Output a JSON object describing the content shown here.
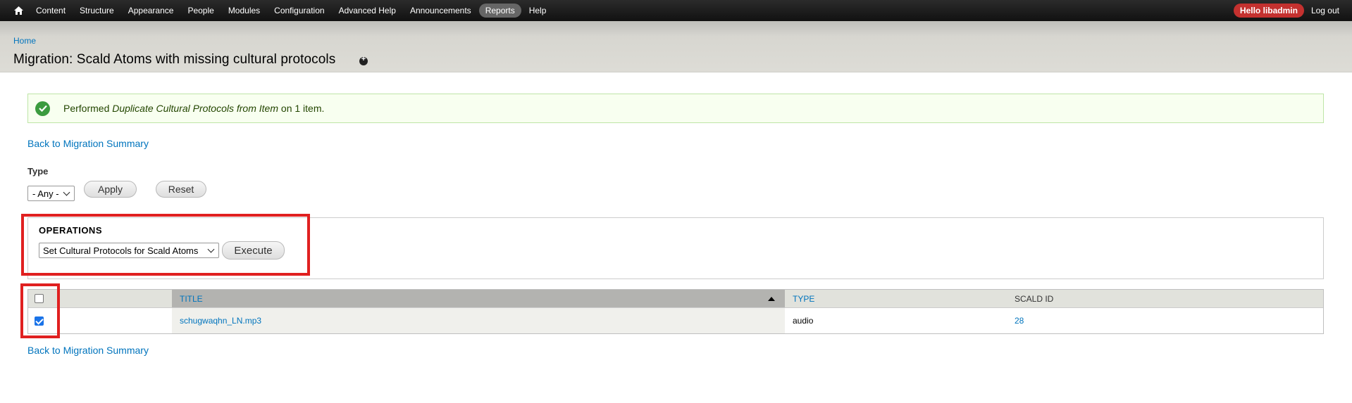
{
  "toolbar": {
    "home_icon": "home-icon",
    "items": [
      {
        "label": "Content"
      },
      {
        "label": "Structure"
      },
      {
        "label": "Appearance"
      },
      {
        "label": "People"
      },
      {
        "label": "Modules"
      },
      {
        "label": "Configuration"
      },
      {
        "label": "Advanced Help"
      },
      {
        "label": "Announcements"
      },
      {
        "label": "Reports",
        "active": true
      },
      {
        "label": "Help"
      }
    ],
    "hello_prefix": "Hello",
    "username": "libadmin",
    "logout": "Log out",
    "accent_color": "#c4312f"
  },
  "header": {
    "breadcrumb": "Home",
    "title": "Migration: Scald Atoms with missing cultural protocols"
  },
  "message": {
    "prefix": "Performed ",
    "operation": "Duplicate Cultural Protocols from Item",
    "suffix": " on 1 item.",
    "status": "success"
  },
  "links": {
    "back": "Back to Migration Summary"
  },
  "filters": {
    "type_label": "Type",
    "type_value": "- Any -",
    "apply": "Apply",
    "reset": "Reset"
  },
  "operations": {
    "legend": "OPERATIONS",
    "selected": "Set Cultural Protocols for Scald Atoms",
    "execute": "Execute"
  },
  "table": {
    "columns": [
      "TITLE",
      "TYPE",
      "SCALD ID"
    ],
    "rows": [
      {
        "checked": true,
        "title": "schugwaqhn_LN.mp3",
        "type": "audio",
        "scald_id": "28"
      }
    ]
  }
}
